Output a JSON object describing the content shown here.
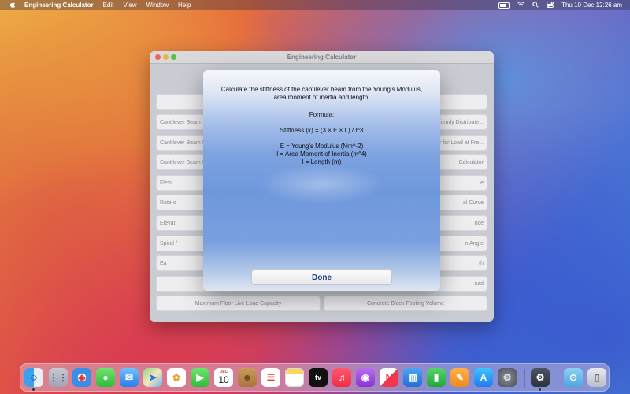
{
  "menubar": {
    "app_name": "Engineering Calculator",
    "menus": [
      "Edit",
      "View",
      "Window",
      "Help"
    ],
    "datetime": "Thu 10 Dec  12:26 am"
  },
  "window": {
    "title": "Engineering Calculator",
    "left_buttons": [
      "",
      "Cantilever Beam",
      "Cantilever Beam St",
      "Cantilever Beam St",
      "Flexi",
      "Rate o",
      "Elevati",
      "Spiral /",
      "Ea",
      "",
      "Maximum Floor Live Load Capacity"
    ],
    "right_buttons": [
      "",
      "formly Distribute...",
      "tor for Load at Fre...",
      "Calculator",
      "e",
      "al Curve",
      "nce",
      "n Angle",
      "th",
      "oad",
      "Concrete Block Footing Volume"
    ]
  },
  "sheet": {
    "description": "Calculate the stiffness of the cantilever beam from the Young's Modulus, area moment of inertia and length.",
    "formula_heading": "Formula:",
    "formula": "Stiffness (k) = (3 × E × I ) / l^3",
    "legend_e": "E = Young's Modulus (Nm^-2)",
    "legend_i": "I = Area Moment of Inertia (m^4)",
    "legend_l": "l = Length (m)",
    "done_label": "Done"
  },
  "dock": {
    "calendar_month": "DEC",
    "calendar_day": "10",
    "apps": [
      "finder-icon",
      "launchpad-icon",
      "safari-icon",
      "messages-icon",
      "mail-icon",
      "maps-icon",
      "photos-icon",
      "facetime-icon",
      "calendar-icon",
      "contacts-icon",
      "reminders-icon",
      "notes-icon",
      "tv-icon",
      "music-icon",
      "podcasts-icon",
      "news-icon",
      "keynote-icon",
      "numbers-icon",
      "pages-icon",
      "app-store-icon",
      "system-preferences-icon",
      "engineering-calculator-icon",
      "downloads-folder-icon",
      "trash-icon"
    ]
  }
}
